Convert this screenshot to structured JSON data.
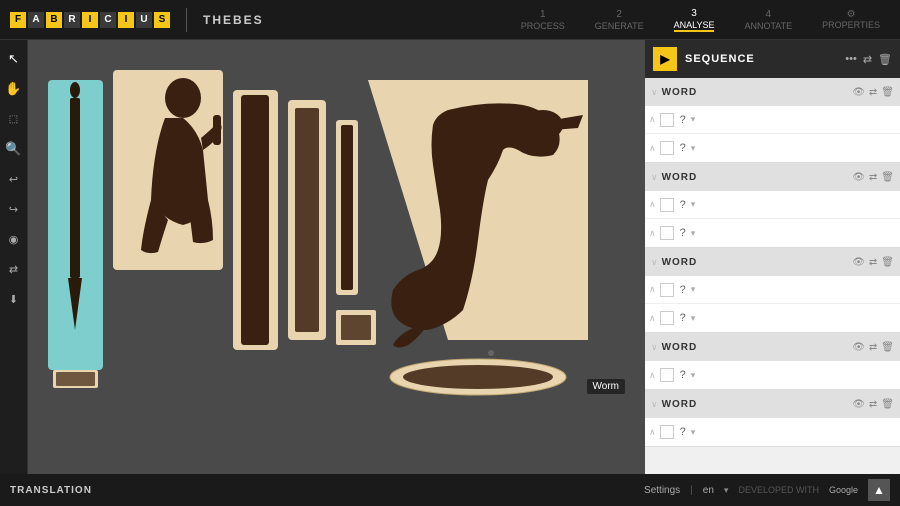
{
  "app": {
    "logo_letters": [
      "F",
      "A",
      "B",
      "R",
      "I",
      "C",
      "I",
      "U",
      "S"
    ],
    "logo_letter_styles": [
      "bg-yellow",
      "bg-dark",
      "bg-yellow",
      "bg-dark",
      "bg-yellow",
      "bg-dark",
      "bg-yellow",
      "bg-dark",
      "bg-yellow"
    ],
    "subtitle": "THEBES",
    "divider": "|"
  },
  "nav": {
    "steps": [
      {
        "num": "1",
        "label": "PROCESS",
        "active": false
      },
      {
        "num": "2",
        "label": "GENERATE",
        "active": false
      },
      {
        "num": "3",
        "label": "ANALYSE",
        "active": true
      },
      {
        "num": "4",
        "label": "ANNOTATE",
        "active": false
      },
      {
        "num": "⚙",
        "label": "PROPERTIES",
        "active": false,
        "is_gear": true
      }
    ]
  },
  "toolbar": {
    "tools": [
      {
        "icon": "↖",
        "name": "select"
      },
      {
        "icon": "✋",
        "name": "pan"
      },
      {
        "icon": "⤢",
        "name": "select-rect"
      },
      {
        "icon": "🔍",
        "name": "zoom"
      },
      {
        "icon": "↩",
        "name": "undo"
      },
      {
        "icon": "⟳",
        "name": "redo"
      },
      {
        "icon": "◎",
        "name": "draw"
      },
      {
        "icon": "⇄",
        "name": "transform"
      },
      {
        "icon": "⬇",
        "name": "download"
      }
    ]
  },
  "panel": {
    "arrow_icon": "▶",
    "title": "SEQUENCE",
    "menu_icon": "•••",
    "share_icon": "⇄",
    "delete_icon": "🗑",
    "words": [
      {
        "label": "WORD",
        "glyphs": [
          {
            "question": "?"
          },
          {
            "question": "?"
          }
        ]
      },
      {
        "label": "WORD",
        "glyphs": [
          {
            "question": "?"
          },
          {
            "question": "?"
          }
        ]
      },
      {
        "label": "WORD",
        "glyphs": [
          {
            "question": "?"
          },
          {
            "question": "?"
          }
        ]
      },
      {
        "label": "WORD",
        "glyphs": [
          {
            "question": "?"
          }
        ]
      },
      {
        "label": "WORD",
        "glyphs": [
          {
            "question": "?"
          }
        ]
      }
    ]
  },
  "bottom": {
    "translation_label": "TRANSLATION",
    "settings_label": "Settings",
    "lang": "en",
    "developed_with": "DEVELOPED WITH",
    "google": "Google"
  },
  "detected": {
    "worm_label": "Worm"
  }
}
